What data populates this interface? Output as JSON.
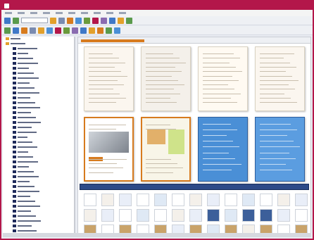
{
  "window": {
    "title": ""
  },
  "menu": {
    "items": [
      "",
      "",
      "",
      "",
      "",
      "",
      "",
      "",
      "",
      ""
    ]
  },
  "sidebar": {
    "rows": 41
  },
  "gallery": {
    "top_label": "",
    "bottom_label": ""
  },
  "filmstrip": {
    "label": "",
    "rows": 3
  },
  "colors": {
    "frame": "#b3174a",
    "accent_orange": "#d77b1e",
    "blue_page": "#4a8fd6",
    "dark_strip": "#2d4a88"
  }
}
